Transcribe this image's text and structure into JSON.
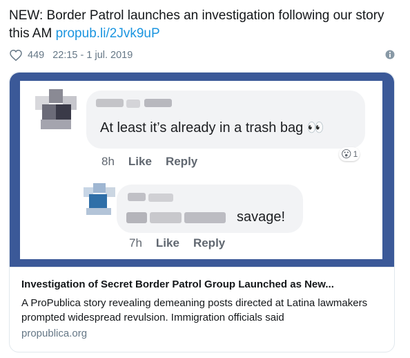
{
  "tweet": {
    "text": "NEW: Border Patrol launches an investigation following our story this AM",
    "link": "propub.li/2Jvk9uP",
    "likes": "449",
    "timestamp": "22:15 - 1 jul. 2019"
  },
  "screenshot": {
    "comment1": {
      "text": "At least it’s already in a trash bag",
      "emoji": "👀",
      "time": "8h",
      "like": "Like",
      "reply": "Reply",
      "reaction_emoji": "😮",
      "reaction_count": "1"
    },
    "comment2": {
      "text": "savage!",
      "time": "7h",
      "like": "Like",
      "reply": "Reply"
    }
  },
  "card": {
    "title": "Investigation of Secret Border Patrol Group Launched as New...",
    "description": "A ProPublica story revealing demeaning posts directed at Latina lawmakers prompted widespread revulsion. Immigration officials said",
    "domain": "propublica.org"
  },
  "colors": {
    "link": "#1b95e0",
    "frame": "#3b5998",
    "muted": "#657786"
  },
  "icons": {
    "like": "heart-outline-icon",
    "info": "info-icon"
  }
}
